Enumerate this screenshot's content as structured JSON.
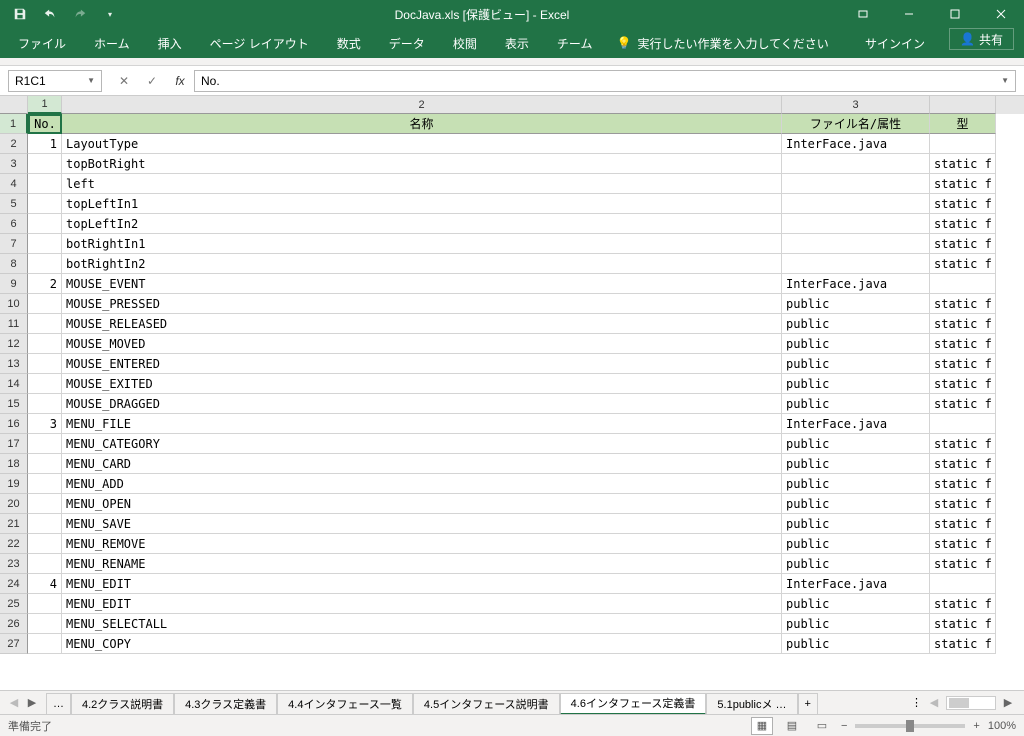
{
  "titlebar": {
    "title": "DocJava.xls  [保護ビュー] - Excel"
  },
  "ribbon": {
    "tabs": [
      "ファイル",
      "ホーム",
      "挿入",
      "ページ レイアウト",
      "数式",
      "データ",
      "校閲",
      "表示",
      "チーム"
    ],
    "tellme": "実行したい作業を入力してください",
    "signin": "サインイン",
    "share": "共有"
  },
  "formula": {
    "namebox": "R1C1",
    "value": "No."
  },
  "columns": [
    "1",
    "2",
    "3",
    "型"
  ],
  "header_row": {
    "no": "No.",
    "name": "名称",
    "file": "ファイル名/属性",
    "type": "型"
  },
  "rows": [
    {
      "r": "2",
      "no": "1",
      "name": "LayoutType",
      "file": "InterFace.java",
      "type": ""
    },
    {
      "r": "3",
      "no": "",
      "name": "topBotRight",
      "file": "",
      "type": "static f"
    },
    {
      "r": "4",
      "no": "",
      "name": "left",
      "file": "",
      "type": "static f"
    },
    {
      "r": "5",
      "no": "",
      "name": "topLeftIn1",
      "file": "",
      "type": "static f"
    },
    {
      "r": "6",
      "no": "",
      "name": "topLeftIn2",
      "file": "",
      "type": "static f"
    },
    {
      "r": "7",
      "no": "",
      "name": "botRightIn1",
      "file": "",
      "type": "static f"
    },
    {
      "r": "8",
      "no": "",
      "name": "botRightIn2",
      "file": "",
      "type": "static f"
    },
    {
      "r": "9",
      "no": "2",
      "name": "MOUSE_EVENT",
      "file": "InterFace.java",
      "type": ""
    },
    {
      "r": "10",
      "no": "",
      "name": "MOUSE_PRESSED",
      "file": "public",
      "type": "static f"
    },
    {
      "r": "11",
      "no": "",
      "name": "MOUSE_RELEASED",
      "file": "public",
      "type": "static f"
    },
    {
      "r": "12",
      "no": "",
      "name": "MOUSE_MOVED",
      "file": "public",
      "type": "static f"
    },
    {
      "r": "13",
      "no": "",
      "name": "MOUSE_ENTERED",
      "file": "public",
      "type": "static f"
    },
    {
      "r": "14",
      "no": "",
      "name": "MOUSE_EXITED",
      "file": "public",
      "type": "static f"
    },
    {
      "r": "15",
      "no": "",
      "name": "MOUSE_DRAGGED",
      "file": "public",
      "type": "static f"
    },
    {
      "r": "16",
      "no": "3",
      "name": "MENU_FILE",
      "file": "InterFace.java",
      "type": ""
    },
    {
      "r": "17",
      "no": "",
      "name": "MENU_CATEGORY",
      "file": "public",
      "type": "static f"
    },
    {
      "r": "18",
      "no": "",
      "name": "MENU_CARD",
      "file": "public",
      "type": "static f"
    },
    {
      "r": "19",
      "no": "",
      "name": "MENU_ADD",
      "file": "public",
      "type": "static f"
    },
    {
      "r": "20",
      "no": "",
      "name": "MENU_OPEN",
      "file": "public",
      "type": "static f"
    },
    {
      "r": "21",
      "no": "",
      "name": "MENU_SAVE",
      "file": "public",
      "type": "static f"
    },
    {
      "r": "22",
      "no": "",
      "name": "MENU_REMOVE",
      "file": "public",
      "type": "static f"
    },
    {
      "r": "23",
      "no": "",
      "name": "MENU_RENAME",
      "file": "public",
      "type": "static f"
    },
    {
      "r": "24",
      "no": "4",
      "name": "MENU_EDIT",
      "file": "InterFace.java",
      "type": ""
    },
    {
      "r": "25",
      "no": "",
      "name": "MENU_EDIT",
      "file": "public",
      "type": "static f"
    },
    {
      "r": "26",
      "no": "",
      "name": "MENU_SELECTALL",
      "file": "public",
      "type": "static f"
    },
    {
      "r": "27",
      "no": "",
      "name": "MENU_COPY",
      "file": "public",
      "type": "static f"
    }
  ],
  "sheets": {
    "ell": "…",
    "tabs": [
      "4.2クラス説明書",
      "4.3クラス定義書",
      "4.4インタフェース一覧",
      "4.5インタフェース説明書",
      "4.6インタフェース定義書",
      "5.1publicメ …"
    ],
    "active": 4,
    "add": "+"
  },
  "status": {
    "ready": "準備完了",
    "zoom": "100%"
  }
}
